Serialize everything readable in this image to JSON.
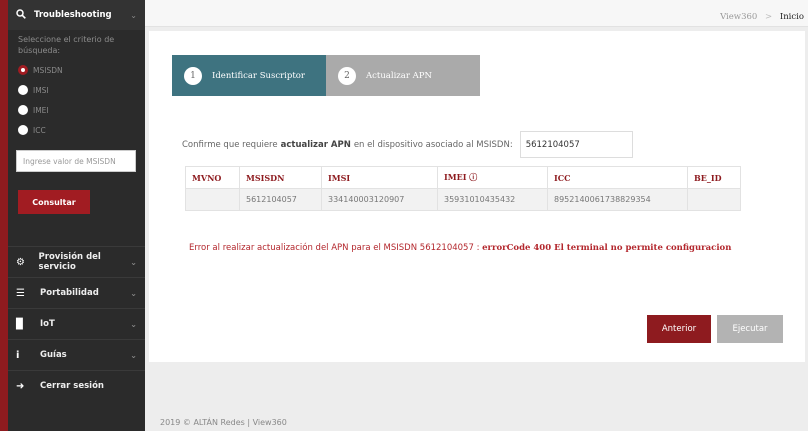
{
  "sidebar": {
    "header": {
      "icon": "search-icon",
      "title": "Troubleshooting"
    },
    "hint": "Seleccione el criterio de búsqueda:",
    "criteria": [
      {
        "label": "MSISDN",
        "selected": true
      },
      {
        "label": "IMSI",
        "selected": false
      },
      {
        "label": "IMEI",
        "selected": false
      },
      {
        "label": "ICC",
        "selected": false
      }
    ],
    "input_placeholder": "Ingrese valor de MSISDN",
    "consult_label": "Consultar",
    "menu": [
      {
        "icon": "cogs-icon",
        "label": "Provisión del servicio"
      },
      {
        "icon": "sliders-icon",
        "label": "Portabilidad"
      },
      {
        "icon": "document-icon",
        "label": "IoT"
      },
      {
        "icon": "info-icon",
        "label": "Guías"
      },
      {
        "icon": "sign-out-icon",
        "label": "Cerrar sesión"
      }
    ]
  },
  "breadcrumb": {
    "root": "View360",
    "separator": ">",
    "current": "Inicio"
  },
  "steps": [
    {
      "num": "1",
      "label": "Identificar Suscriptor",
      "active": true
    },
    {
      "num": "2",
      "label": "Actualizar APN",
      "active": false
    }
  ],
  "confirm": {
    "prefix": "Confirme que requiere",
    "action": "actualizar APN",
    "suffix": "en el dispositivo asociado al MSISDN:",
    "msisdn": "5612104057"
  },
  "table": {
    "headers": [
      "MVNO",
      "MSISDN",
      "IMSI",
      "IMEI ⓘ",
      "ICC",
      "BE_ID"
    ],
    "rows": [
      [
        "",
        "5612104057",
        "334140003120907",
        "35931010435432",
        "8952140061738829354",
        ""
      ]
    ]
  },
  "error": {
    "message": "Error al realizar actualización del APN para el MSISDN 5612104057 :",
    "detail": "errorCode 400 El terminal no permite configuracion"
  },
  "buttons": {
    "prev": "Anterior",
    "execute": "Ejecutar"
  },
  "footer": "2019 © ALTÁN Redes | View360",
  "colors": {
    "brand": "#8e1b1f",
    "step_active": "#3e7380",
    "step_inactive": "#aaaaaa",
    "sidebar": "#2b2b2b"
  }
}
